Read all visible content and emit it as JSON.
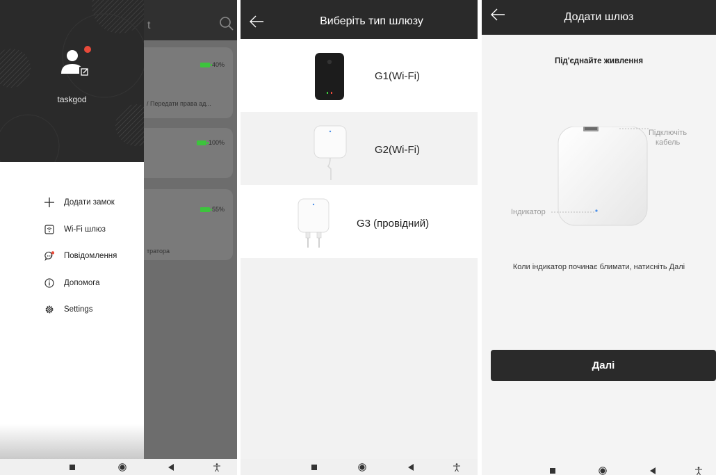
{
  "screen1": {
    "background_header_title": "t",
    "username": "taskgod",
    "menu": [
      {
        "icon": "plus-icon",
        "label": "Додати замок"
      },
      {
        "icon": "wifi-gateway-icon",
        "label": "Wi-Fi шлюз"
      },
      {
        "icon": "message-icon",
        "label": "Повідомлення"
      },
      {
        "icon": "info-icon",
        "label": "Допомога"
      },
      {
        "icon": "gear-icon",
        "label": "Settings"
      }
    ],
    "background_cards": [
      {
        "battery": "40%",
        "battery_color": "#3cc43c",
        "subtitle": "/ Передати права ад..."
      },
      {
        "battery": "100%",
        "battery_color": "#3cc43c",
        "subtitle": ""
      },
      {
        "battery": "55%",
        "battery_color": "#3cc43c",
        "subtitle": "тратора"
      }
    ]
  },
  "screen2": {
    "title": "Виберіть тип шлюзу",
    "gateways": [
      {
        "name": "G1(Wi-Fi)"
      },
      {
        "name": "G2(Wi-Fi)"
      },
      {
        "name": "G3 (провідний)"
      }
    ]
  },
  "screen3": {
    "title": "Додати шлюз",
    "subtitle": "Під'єднайте живлення",
    "cable_label_line1": "Підключіть",
    "cable_label_line2": "кабель",
    "indicator_label": "Індикатор",
    "hint": "Коли індикатор починає блимати, натисніть Далі",
    "next_button": "Далі"
  },
  "colors": {
    "header_dark": "#2a2a2a",
    "notification_dot": "#e84a3a",
    "indicator_led": "#4a8fe8"
  }
}
